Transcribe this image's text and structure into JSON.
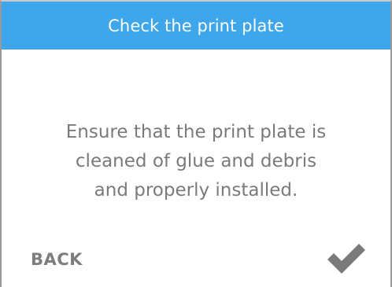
{
  "header": {
    "title": "Check the print plate",
    "background_color": "#3ea6eb"
  },
  "message": {
    "lines": [
      "Ensure that the print plate is",
      "cleaned of glue and debris",
      "and properly installed."
    ]
  },
  "actions": {
    "back_label": "BACK",
    "confirm_icon": "checkmark-icon"
  }
}
